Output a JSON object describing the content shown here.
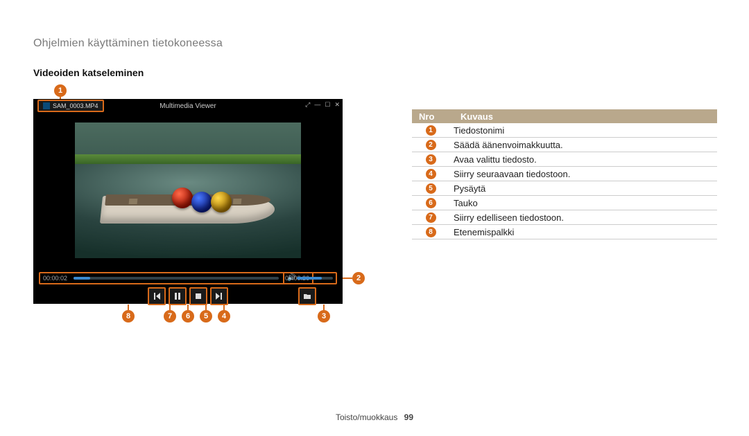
{
  "page": {
    "title": "Ohjelmien käyttäminen tietokoneessa",
    "section_title": "Videoiden katseleminen",
    "footer_label": "Toisto/muokkaus",
    "footer_page": "99"
  },
  "viewer": {
    "filename": "SAM_0003.MP4",
    "window_title": "Multimedia Viewer",
    "time_current": "00:00:02",
    "time_total": "00:00:26"
  },
  "callouts": {
    "c1": "1",
    "c2": "2",
    "c3": "3",
    "c4": "4",
    "c5": "5",
    "c6": "6",
    "c7": "7",
    "c8": "8"
  },
  "table": {
    "head_nro": "Nro",
    "head_kuvaus": "Kuvaus",
    "rows": [
      {
        "n": "1",
        "desc": "Tiedostonimi"
      },
      {
        "n": "2",
        "desc": "Säädä äänenvoimakkuutta."
      },
      {
        "n": "3",
        "desc": "Avaa valittu tiedosto."
      },
      {
        "n": "4",
        "desc": "Siirry seuraavaan tiedostoon."
      },
      {
        "n": "5",
        "desc": "Pysäytä"
      },
      {
        "n": "6",
        "desc": "Tauko"
      },
      {
        "n": "7",
        "desc": "Siirry edelliseen tiedostoon."
      },
      {
        "n": "8",
        "desc": "Etenemispalkki"
      }
    ]
  }
}
